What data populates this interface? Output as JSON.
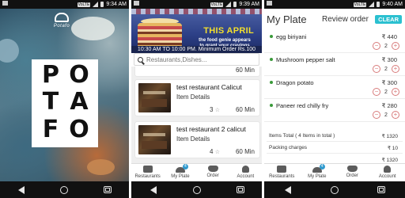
{
  "status": {
    "screen1_time": "9:34 AM",
    "screen2_time": "9:39 AM",
    "screen3_time": "9:40 AM",
    "sim_label": "VoLTE"
  },
  "splash": {
    "logo_text": "Potafo",
    "brand_letters": [
      "P",
      "O",
      "T",
      "A",
      "F",
      "O"
    ]
  },
  "banner": {
    "title": "THIS APRIL",
    "subtitle": "the food genie appears to grant your cravings",
    "hours": "10:30 AM TO 10:00 PM. Minimum Order Rs.100"
  },
  "search": {
    "placeholder": "Restaurants,Dishes..."
  },
  "restaurants": [
    {
      "name": "",
      "details": "",
      "rating": "",
      "time": "60 Min"
    },
    {
      "name": "test restaurant Calicut",
      "details": "Item Details",
      "rating": "3",
      "time": "60 Min"
    },
    {
      "name": "test restaurant 2 calicut",
      "details": "Item Details",
      "rating": "4",
      "time": "60 Min"
    }
  ],
  "bottom_nav": [
    {
      "label": "Restaurants"
    },
    {
      "label": "My Plate",
      "badge": "4"
    },
    {
      "label": "Order"
    },
    {
      "label": "Account"
    }
  ],
  "plate": {
    "title": "My Plate",
    "review_label": "Review order",
    "clear_label": "CLEAR",
    "items": [
      {
        "name": "egg biriyani",
        "price": "₹ 440",
        "qty": "2"
      },
      {
        "name": "Mushroom pepper salt",
        "price": "₹ 300",
        "qty": "2"
      },
      {
        "name": "Dragon potato",
        "price": "₹ 300",
        "qty": "2"
      },
      {
        "name": "Paneer red chilly fry",
        "price": "₹ 280",
        "qty": "2"
      }
    ],
    "summary": [
      {
        "label": "Items Total ( 4 Items in total )",
        "value": "₹ 1320"
      },
      {
        "label": "Packing charges",
        "value": "₹ 10"
      },
      {
        "label": "",
        "value": "₹ 1320"
      }
    ]
  },
  "colors": {
    "accent": "#2bc0d0",
    "veg_dot": "#3a9a3a",
    "qty_button": "#d87b7b",
    "status_bar": "#111111"
  }
}
